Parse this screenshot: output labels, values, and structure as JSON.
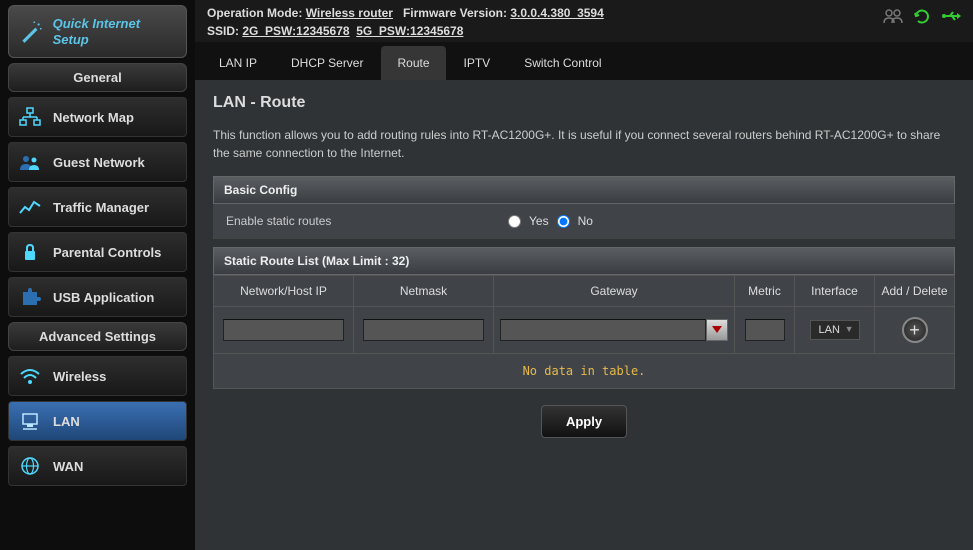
{
  "quick_setup": {
    "label": "Quick Internet Setup"
  },
  "sections": {
    "general": {
      "title": "General",
      "items": [
        {
          "label": "Network Map"
        },
        {
          "label": "Guest Network"
        },
        {
          "label": "Traffic Manager"
        },
        {
          "label": "Parental Controls"
        },
        {
          "label": "USB Application"
        }
      ]
    },
    "advanced": {
      "title": "Advanced Settings",
      "items": [
        {
          "label": "Wireless"
        },
        {
          "label": "LAN"
        },
        {
          "label": "WAN"
        }
      ]
    }
  },
  "topbar": {
    "op_mode_label": "Operation Mode:",
    "op_mode_value": "Wireless router",
    "fw_label": "Firmware Version:",
    "fw_value": "3.0.0.4.380_3594",
    "ssid_label": "SSID:",
    "ssid_2g": "2G_PSW:12345678",
    "ssid_5g": "5G_PSW:12345678"
  },
  "tabs": [
    {
      "label": "LAN IP"
    },
    {
      "label": "DHCP Server"
    },
    {
      "label": "Route"
    },
    {
      "label": "IPTV"
    },
    {
      "label": "Switch Control"
    }
  ],
  "page": {
    "title": "LAN - Route",
    "description": "This function allows you to add routing rules into RT-AC1200G+. It is useful if you connect several routers behind RT-AC1200G+ to share the same connection to the Internet."
  },
  "basic_config": {
    "header": "Basic Config",
    "row_label": "Enable static routes",
    "yes": "Yes",
    "no": "No",
    "selected": "no"
  },
  "route_list": {
    "header": "Static Route List (Max Limit : 32)",
    "cols": {
      "network": "Network/Host IP",
      "netmask": "Netmask",
      "gateway": "Gateway",
      "metric": "Metric",
      "interface": "Interface",
      "action": "Add / Delete"
    },
    "interface_value": "LAN",
    "empty_msg": "No data in table."
  },
  "apply": "Apply"
}
